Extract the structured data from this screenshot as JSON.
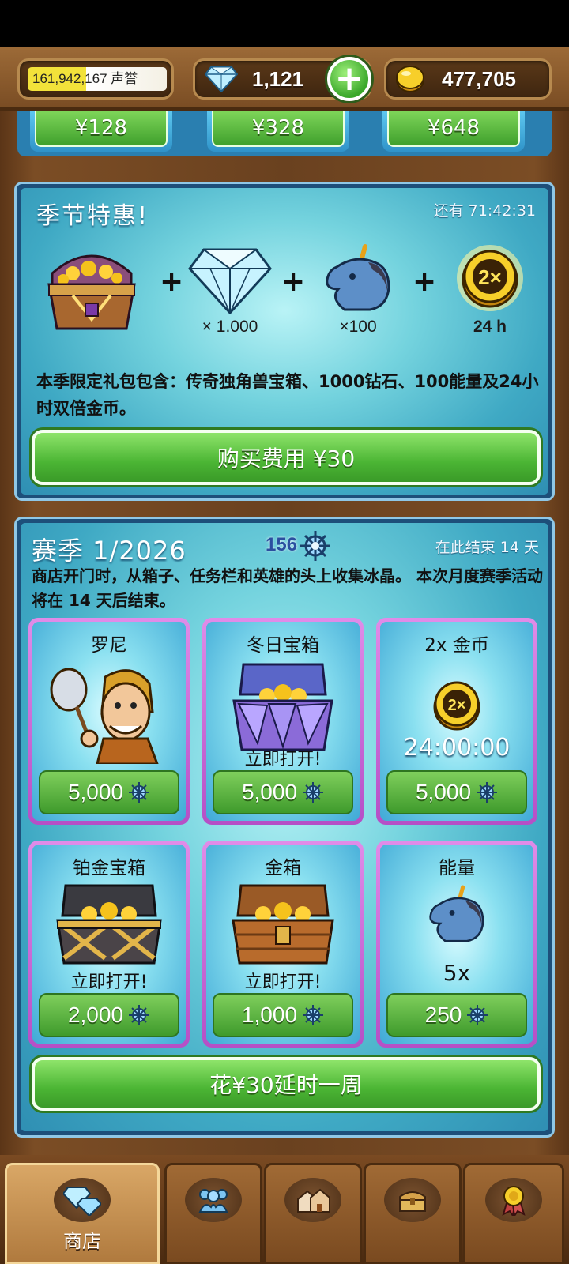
{
  "topbar": {
    "reputation": "161,942,167 声誉",
    "reputation_progress_fraction": 0.42,
    "gems": "1,121",
    "coins": "477,705"
  },
  "purchase_strip": {
    "prices": [
      "¥128",
      "¥328",
      "¥648"
    ]
  },
  "offer": {
    "title": "季节特惠!",
    "timer": "还有 71:42:31",
    "items": [
      {
        "icon": "treasure-chest-icon",
        "qty": ""
      },
      {
        "icon": "diamond-icon",
        "qty": "× 1.000"
      },
      {
        "icon": "unicorn-icon",
        "qty": "×100"
      },
      {
        "icon": "double-coin-icon",
        "qty": "24 h"
      }
    ],
    "coin_badge": "2×",
    "description": "本季限定礼包包含：传奇独角兽宝箱、1000钻石、100能量及24小时双倍金币。",
    "buy_label": "购买费用 ¥30"
  },
  "season": {
    "title": "赛季 1/2026",
    "points": "156",
    "ends": "在此结束 14 天",
    "description": "商店开门时，从箱子、任务栏和英雄的头上收集冰晶。 本次月度赛季活动将在 14 天后结束。",
    "cards": [
      {
        "title": "罗尼",
        "sub": "",
        "price": "5,000",
        "icon": "hero-ronnie-icon"
      },
      {
        "title": "冬日宝箱",
        "sub": "立即打开!",
        "price": "5,000",
        "icon": "winter-chest-icon"
      },
      {
        "title": "2x 金币",
        "sub": "24:00:00",
        "price": "5,000",
        "icon": "double-coin-icon"
      },
      {
        "title": "铂金宝箱",
        "sub": "立即打开!",
        "price": "2,000",
        "icon": "platinum-chest-icon"
      },
      {
        "title": "金箱",
        "sub": "立即打开!",
        "price": "1,000",
        "icon": "gold-chest-icon"
      },
      {
        "title": "能量",
        "sub": "5x",
        "price": "250",
        "icon": "unicorn-icon"
      }
    ],
    "extend_label": "花¥30延时一周"
  },
  "nav": {
    "shop_label": "商店",
    "tabs": [
      "shop-tab",
      "heroes-tab",
      "buildings-tab",
      "chests-tab",
      "achievements-tab"
    ]
  },
  "colors": {
    "wood": "#7a4d24",
    "panel_blue": "#3fa9c4",
    "button_green": "#4bb534",
    "card_border": "#c964d8"
  }
}
